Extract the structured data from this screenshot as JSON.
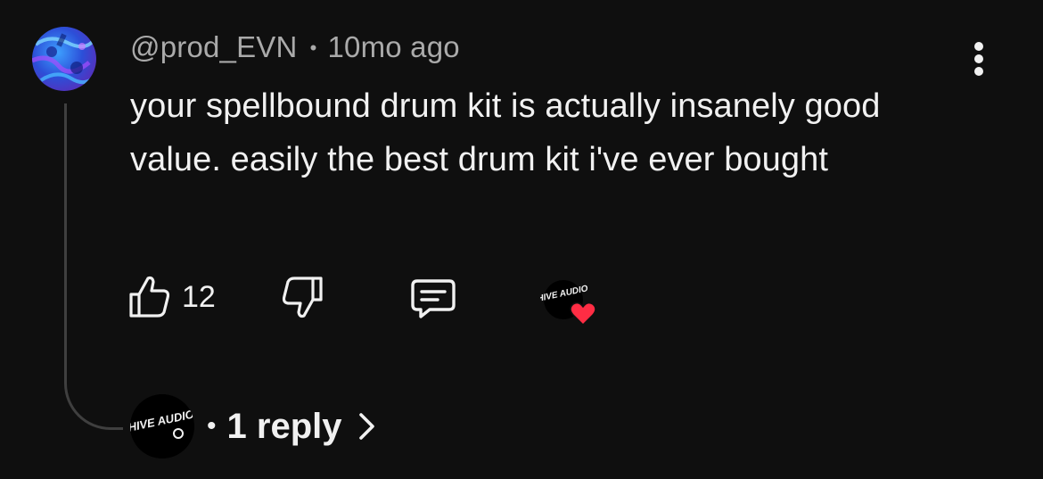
{
  "comment": {
    "username": "@prod_EVN",
    "separator": "•",
    "age": "10mo ago",
    "text": "your spellbound drum kit is actually insanely good value. easily the best drum kit i've ever bought"
  },
  "actions": {
    "like_count": "12"
  },
  "creator": {
    "logo_text": "HIVE AUDIO"
  },
  "replies": {
    "separator": "•",
    "label": "1 reply"
  },
  "icons": {
    "menu": "more-vert-icon",
    "like": "thumbs-up-icon",
    "dislike": "thumbs-down-icon",
    "reply": "comment-icon",
    "heart": "heart-icon",
    "chevron": "chevron-right-icon"
  },
  "colors": {
    "background": "#0f0f0f",
    "text": "#f1f1f1",
    "secondary_text": "#aaaaaa",
    "heart": "#ff2d44"
  }
}
